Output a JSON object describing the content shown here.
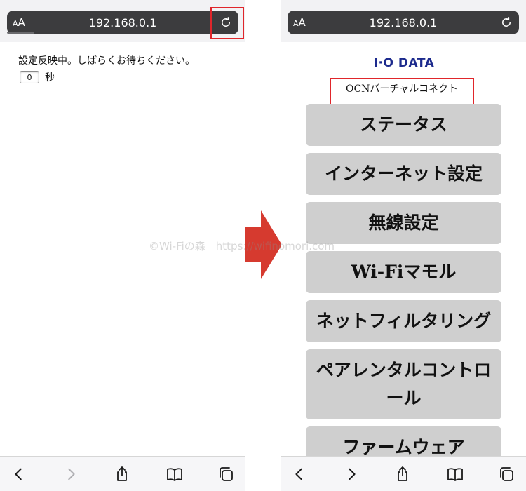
{
  "left_screen": {
    "address_bar": {
      "aa_small": "A",
      "aa_large": "A",
      "url": "192.168.0.1"
    },
    "content": {
      "message": "設定反映中。しばらくお待ちください。",
      "countdown_value": "0",
      "countdown_unit": "秒"
    }
  },
  "right_screen": {
    "address_bar": {
      "aa_small": "A",
      "aa_large": "A",
      "url": "192.168.0.1"
    },
    "logo_text": "I·O DATA",
    "model_label": "OCNバーチャルコネクト",
    "menu": [
      "ステータス",
      "インターネット設定",
      "無線設定",
      "Wi-Fiマモル",
      "ネットフィルタリング",
      "ペアレンタルコントロール",
      "ファームウェア"
    ]
  },
  "watermark": "©Wi-Fiの森　https://wifinomori.com",
  "colors": {
    "highlight": "#e0262b",
    "arrow": "#d63a2f",
    "address_bar_bg": "#3c3c3e",
    "menu_button_bg": "#cfcfcf",
    "logo": "#1c2a8d"
  },
  "toolbar_icons": [
    "back-icon",
    "forward-icon",
    "share-icon",
    "bookmarks-icon",
    "tabs-icon"
  ]
}
